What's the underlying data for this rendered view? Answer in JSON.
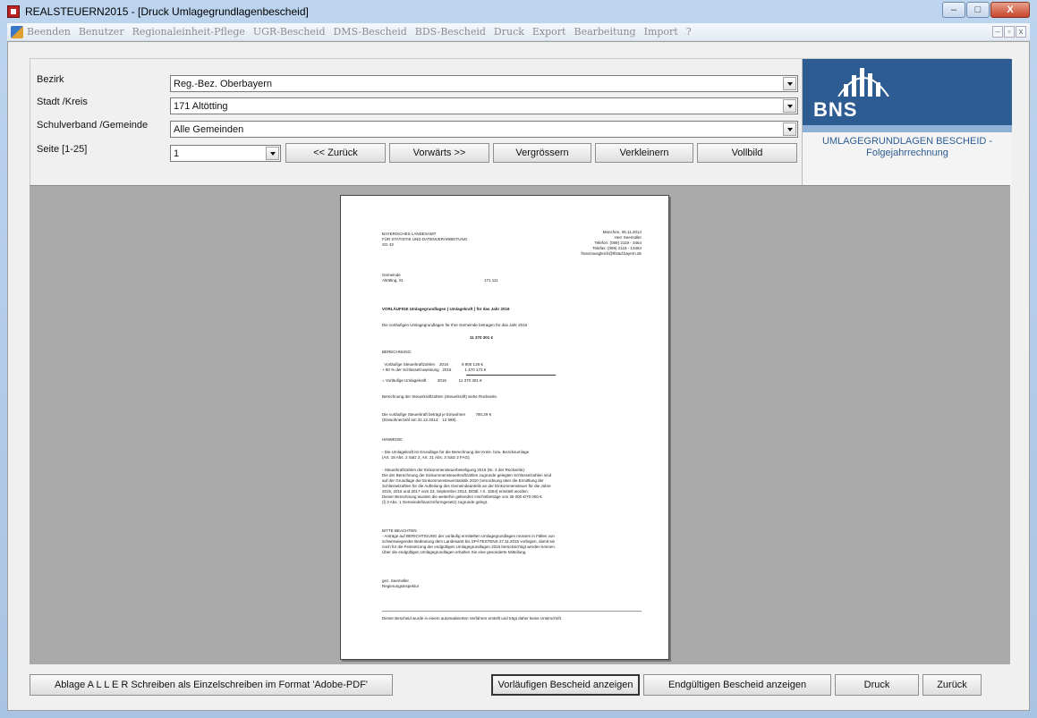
{
  "window": {
    "title": "REALSTEUERN2015 - [Druck Umlagegrundlagenbescheid]",
    "controls": [
      "–",
      "□",
      "X"
    ]
  },
  "menu": {
    "items": [
      "Beenden",
      "Benutzer",
      "Regionaleinheit-Pflege",
      "UGR-Bescheid",
      "DMS-Bescheid",
      "BDS-Bescheid",
      "Druck",
      "Export",
      "Bearbeitung",
      "Import",
      "?"
    ],
    "mdi_controls": [
      "–",
      "▫",
      "x"
    ]
  },
  "form": {
    "bezirk_label": "Bezirk",
    "bezirk_value": "Reg.-Bez. Oberbayern",
    "stadt_label": "Stadt /Kreis",
    "stadt_value": "171  Altötting",
    "schulverband_label": "Schulverband /Gemeinde",
    "schulverband_value": "Alle Gemeinden",
    "seite_label": "Seite [1-25]",
    "seite_value": "1"
  },
  "nav_buttons": {
    "back": "<< Zurück",
    "forward": "Vorwärts >>",
    "enlarge": "Vergrössern",
    "shrink": "Verkleinern",
    "fullscreen": "Vollbild"
  },
  "logo": {
    "text": "BNS",
    "caption_line1": "UMLAGEGRUNDLAGEN BESCHEID -",
    "caption_line2": "Folgejahrrechnung"
  },
  "document": {
    "sender": "BAYERISCHES LANDESAMT\nFÜR STATISTIK UND DATENVERARBEITUNG\nSG 43",
    "contact": "München, 06.11.2014\nHerr Seemüller\nTelefon: (089) 2119 - 3464\nTelefax: (089) 2119 - 13464\nfinanzausgleich@lfstad.bayern.de",
    "recipient": "Gemeinde\nAltötting, St.",
    "recipient_code": "171 111",
    "subject": "VORLÄUFIGE Umlagegrundlagen ( Umlagekraft ) für das Jahr 2016",
    "intro": "Die vorläufigen Umlagegrundlagen für Ihre Gemeinde betragen für das Jahr 2016",
    "total": "11 370 301 €",
    "calc_heading": "BERECHNUNG:",
    "calc_lines": "  Vorläufige Steuerkraftzahlen    2016            9 900 128 €\n+ 80 % der Schlüsselzuweisung   2016            1 470 173 €\n\n= Vorläufige Umlagekraft          2016           11 370 301 €",
    "calc_note": "Berechnung der Steuerkraftzahlen (Steuerkraft) siehe Rückseite.",
    "per_capita": "Die vorläufige Steuerkraft beträgt je Einwohner         780,29 €\n(Einwohnerzahl am 31.12.2014:   12 688).",
    "hints_heading": "HINWEISE:",
    "hint1": "- Die Umlagekraft ist Grundlage für die Berechnung der Kreis- bzw. Bezirksumlage\n(Art. 18 Abs. 2 Satz 2, Art. 21 Abs. 3 Satz 2 FAG).",
    "hint2": "- Steuerkraftzahlen der Einkommensteuerbeteiligung 2016 (Nr. 4 der Rückseite):\nDie der Berechnung der Einkommensteuerkraftzahlen zugrunde gelegten Schlüsselzahlen sind\nauf der Grundlage der Einkommensteuerstatistik 2010 (Verordnung über die Ermittlung der\nSchlüsselzahlen für die Aufteilung des Gemeindeanteils an der Einkommensteuer für die Jahre\n2015, 2016 und 2017 vom 23. September 2014, BGBl. I S. 1554) ermittelt worden.\nDieser Berechnung wurden die weiterhin geltenden Höchstbeträge von 35 000 €/70 000 €\n(§ 3 Abs. 1 Gemeindefinanzreformgesetz) zugrunde gelegt.",
    "notice_heading": "BITTE BEACHTEN:",
    "notice_text": "- Anträge auf BERICHTIGUNG der vorläufig ermittelten Umlagegrundlagen müssen in Fällen von\nschwerwiegender Bedeutung dem Landesamt bis SPÄTESTENS 27.11.2015 vorliegen, damit sie\nnoch für die Festsetzung der endgültigen Umlagegrundlagen 2016 berücksichtigt werden können.\nÜber die endgültigen Umlagegrundlagen erhalten Sie eine gesonderte Mitteilung.",
    "signature": "gez. Seemüller\nRegierungsinspektor",
    "footer": "Dieser Bescheid wurde in einem automatisierten Verfahren erstellt und trägt daher keine Unterschrift."
  },
  "bottom_buttons": {
    "archive": "Ablage  A L L E R  Schreiben als Einzelschreiben  im Format 'Adobe-PDF'",
    "show_prelim": "Vorläufigen Bescheid anzeigen",
    "show_final": "Endgültigen Bescheid anzeigen",
    "print": "Druck",
    "back": "Zurück"
  }
}
